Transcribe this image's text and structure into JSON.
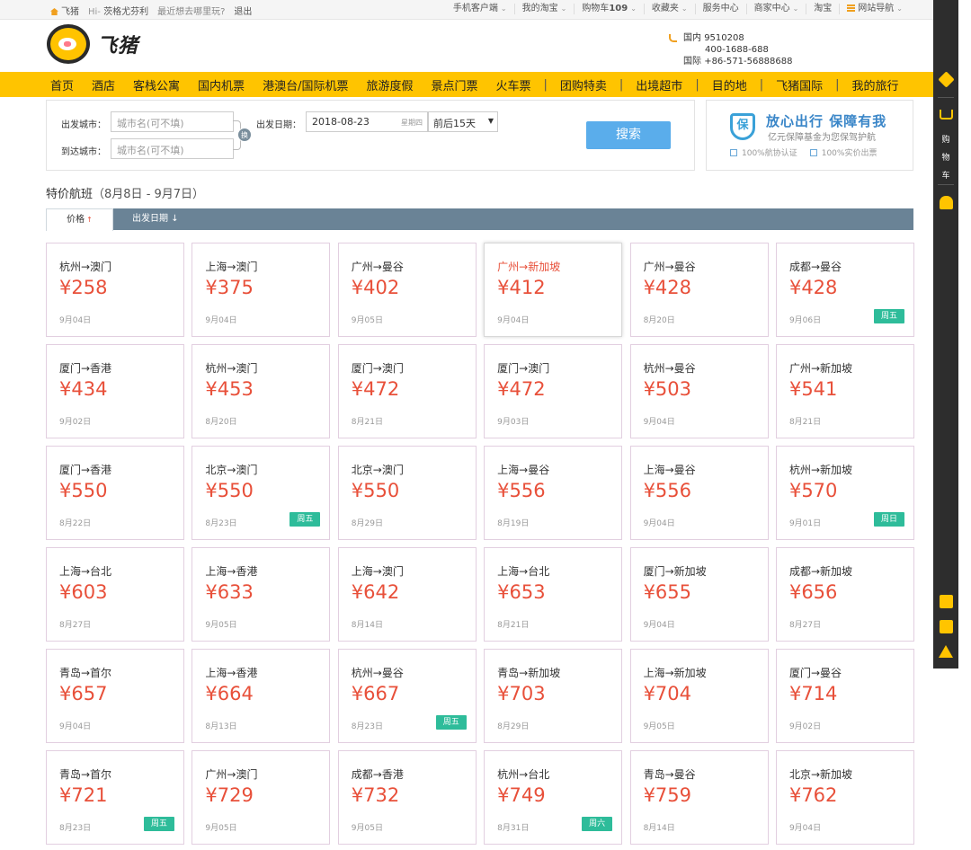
{
  "topbar": {
    "left": [
      "飞猪",
      "Hi-",
      "茨格尤芬利",
      "最近想去哪里玩?",
      "退出"
    ],
    "right": [
      "手机客户端",
      "我的淘宝",
      "购物车",
      "109",
      "收藏夹",
      "服务中心",
      "商家中心",
      "淘宝",
      "网站导航"
    ]
  },
  "header": {
    "logo_text": "飞猪",
    "contact": {
      "label_domestic": "国内",
      "phone1": "9510208",
      "phone2": "400-1688-688",
      "label_intl": "国际",
      "phone3": "+86-571-56888688"
    }
  },
  "nav": [
    "首页",
    "酒店",
    "客栈公寓",
    "国内机票",
    "港澳台/国际机票",
    "旅游度假",
    "景点门票",
    "火车票",
    "团购特卖",
    "出境超市",
    "目的地",
    "飞猪国际",
    "我的旅行"
  ],
  "search": {
    "from_label": "出发城市：",
    "from_placeholder": "城市名(可不填)",
    "to_label": "到达城市：",
    "to_placeholder": "城市名(可不填)",
    "swap_label": "换",
    "date_label": "出发日期：",
    "date_value": "2018-08-23",
    "weekday": "星期四",
    "range_value": "前后15天",
    "button": "搜索"
  },
  "promo": {
    "badge": "保",
    "title": "放心出行 保障有我",
    "subtitle": "亿元保障基金为您保驾护航",
    "tags": [
      "100%航协认证",
      "100%实价出票"
    ]
  },
  "section": {
    "title": "特价航班",
    "range": "（8月8日 - 9月7日）"
  },
  "sort": {
    "price_label": "价格",
    "date_label": "出发日期"
  },
  "flights": [
    {
      "route": "杭州→澳门",
      "price": "¥258",
      "date": "9月04日",
      "tag": ""
    },
    {
      "route": "上海→澳门",
      "price": "¥375",
      "date": "9月04日",
      "tag": ""
    },
    {
      "route": "广州→曼谷",
      "price": "¥402",
      "date": "9月05日",
      "tag": ""
    },
    {
      "route": "广州→新加坡",
      "price": "¥412",
      "date": "9月04日",
      "tag": "",
      "highlight": true
    },
    {
      "route": "广州→曼谷",
      "price": "¥428",
      "date": "8月20日",
      "tag": ""
    },
    {
      "route": "成都→曼谷",
      "price": "¥428",
      "date": "9月06日",
      "tag": "周五"
    },
    {
      "route": "厦门→香港",
      "price": "¥434",
      "date": "9月02日",
      "tag": ""
    },
    {
      "route": "杭州→澳门",
      "price": "¥453",
      "date": "8月20日",
      "tag": ""
    },
    {
      "route": "厦门→澳门",
      "price": "¥472",
      "date": "8月21日",
      "tag": ""
    },
    {
      "route": "厦门→澳门",
      "price": "¥472",
      "date": "9月03日",
      "tag": ""
    },
    {
      "route": "杭州→曼谷",
      "price": "¥503",
      "date": "9月04日",
      "tag": ""
    },
    {
      "route": "广州→新加坡",
      "price": "¥541",
      "date": "8月21日",
      "tag": ""
    },
    {
      "route": "厦门→香港",
      "price": "¥550",
      "date": "8月22日",
      "tag": ""
    },
    {
      "route": "北京→澳门",
      "price": "¥550",
      "date": "8月23日",
      "tag": "周五"
    },
    {
      "route": "北京→澳门",
      "price": "¥550",
      "date": "8月29日",
      "tag": ""
    },
    {
      "route": "上海→曼谷",
      "price": "¥556",
      "date": "8月19日",
      "tag": ""
    },
    {
      "route": "上海→曼谷",
      "price": "¥556",
      "date": "9月04日",
      "tag": ""
    },
    {
      "route": "杭州→新加坡",
      "price": "¥570",
      "date": "9月01日",
      "tag": "周日"
    },
    {
      "route": "上海→台北",
      "price": "¥603",
      "date": "8月27日",
      "tag": ""
    },
    {
      "route": "上海→香港",
      "price": "¥633",
      "date": "9月05日",
      "tag": ""
    },
    {
      "route": "上海→澳门",
      "price": "¥642",
      "date": "8月14日",
      "tag": ""
    },
    {
      "route": "上海→台北",
      "price": "¥653",
      "date": "8月21日",
      "tag": ""
    },
    {
      "route": "厦门→新加坡",
      "price": "¥655",
      "date": "9月04日",
      "tag": ""
    },
    {
      "route": "成都→新加坡",
      "price": "¥656",
      "date": "8月27日",
      "tag": ""
    },
    {
      "route": "青岛→首尔",
      "price": "¥657",
      "date": "9月04日",
      "tag": ""
    },
    {
      "route": "上海→香港",
      "price": "¥664",
      "date": "8月13日",
      "tag": ""
    },
    {
      "route": "杭州→曼谷",
      "price": "¥667",
      "date": "8月23日",
      "tag": "周五"
    },
    {
      "route": "青岛→新加坡",
      "price": "¥703",
      "date": "8月29日",
      "tag": ""
    },
    {
      "route": "上海→新加坡",
      "price": "¥704",
      "date": "9月05日",
      "tag": ""
    },
    {
      "route": "厦门→曼谷",
      "price": "¥714",
      "date": "9月02日",
      "tag": ""
    },
    {
      "route": "青岛→首尔",
      "price": "¥721",
      "date": "8月23日",
      "tag": "周五"
    },
    {
      "route": "广州→澳门",
      "price": "¥729",
      "date": "9月05日",
      "tag": ""
    },
    {
      "route": "成都→香港",
      "price": "¥732",
      "date": "9月05日",
      "tag": ""
    },
    {
      "route": "杭州→台北",
      "price": "¥749",
      "date": "8月31日",
      "tag": "周六"
    },
    {
      "route": "青岛→曼谷",
      "price": "¥759",
      "date": "8月14日",
      "tag": ""
    },
    {
      "route": "北京→新加坡",
      "price": "¥762",
      "date": "9月04日",
      "tag": ""
    }
  ],
  "sidebar": {
    "cart_text": [
      "购",
      "物",
      "车"
    ]
  },
  "colors": {
    "brand_yellow": "#ffc400",
    "price_red": "#e8503a",
    "tag_green": "#2ebc9a",
    "sortbar": "#6a8396",
    "search_button": "#5aadeb"
  }
}
